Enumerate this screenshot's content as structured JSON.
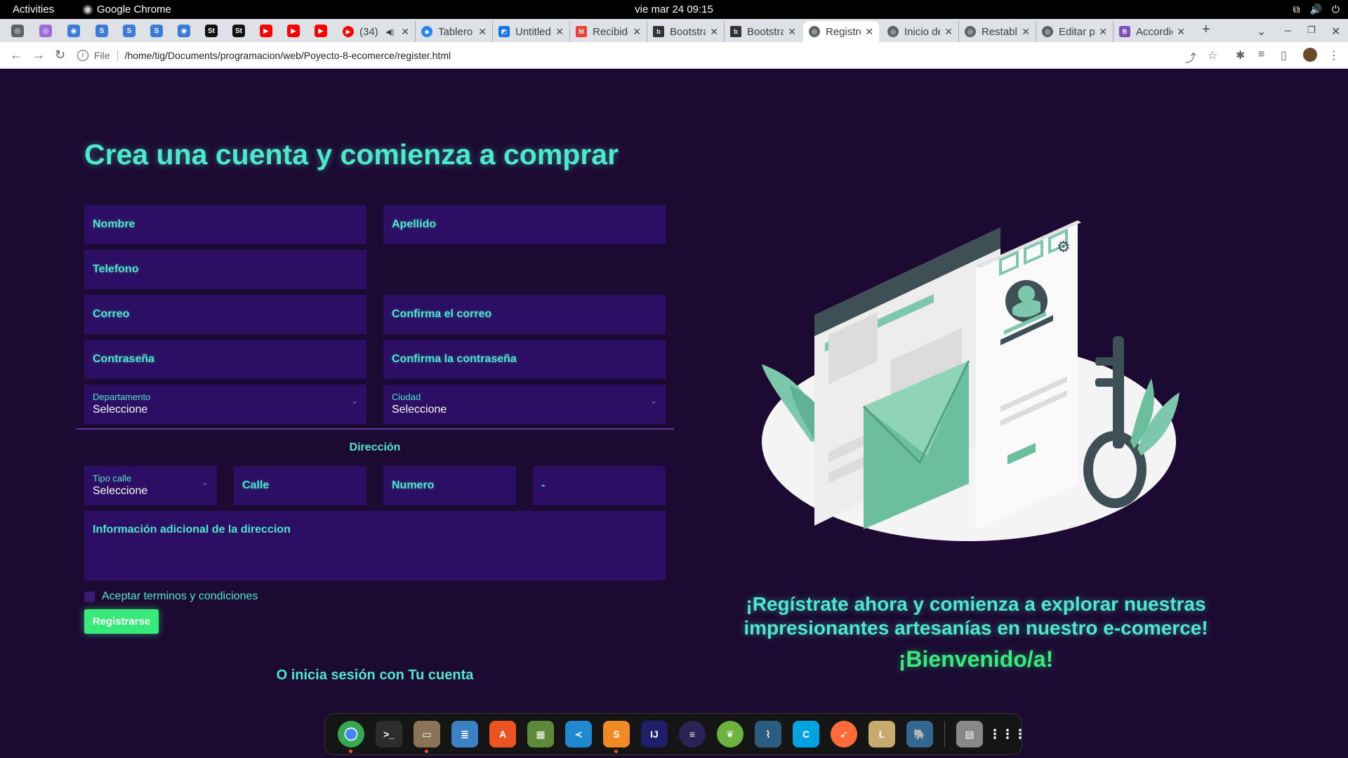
{
  "system_bar": {
    "activities": "Activities",
    "app_name": "Google Chrome",
    "clock": "vie mar 24  09:15"
  },
  "browser": {
    "tabs": [
      {
        "title": "(34)",
        "icon": "youtube-icon",
        "color": "#ff0000"
      },
      {
        "title": "Tablero",
        "icon": "jira-icon",
        "color": "#2684ff"
      },
      {
        "title": "Untitled",
        "icon": "diagram-icon",
        "color": "#1a73e8"
      },
      {
        "title": "Recibidos",
        "icon": "gmail-icon",
        "color": "#ea4335"
      },
      {
        "title": "Bootstrap",
        "icon": "bootstrap-icon",
        "color": "#333333"
      },
      {
        "title": "Bootstrap",
        "icon": "bootstrap-icon",
        "color": "#333333"
      },
      {
        "title": "Registro",
        "icon": "globe-icon",
        "color": "#5f6368"
      },
      {
        "title": "Inicio de",
        "icon": "globe-icon",
        "color": "#5f6368"
      },
      {
        "title": "Restablecer",
        "icon": "globe-icon",
        "color": "#5f6368"
      },
      {
        "title": "Editar p",
        "icon": "globe-icon",
        "color": "#5f6368"
      },
      {
        "title": "Accordion",
        "icon": "bootstrap-b-icon",
        "color": "#7952b3"
      }
    ],
    "address": {
      "scheme": "File",
      "url": "/home/tig/Documents/programacion/web/Poyecto-8-ecomerce/register.html"
    }
  },
  "form": {
    "heading": "Crea una cuenta y comienza a comprar",
    "nombre": "Nombre",
    "apellido": "Apellido",
    "telefono": "Telefono",
    "correo": "Correo",
    "confirma_correo": "Confirma el correo",
    "contrasena": "Contraseña",
    "confirma_contrasena": "Confirma la contraseña",
    "departamento": {
      "label": "Departamento",
      "value": "Seleccione"
    },
    "ciudad": {
      "label": "Ciudad",
      "value": "Seleccione"
    },
    "direccion_label": "Dirección",
    "tipo_calle": {
      "label": "Tipo calle",
      "value": "Seleccione"
    },
    "calle": "Calle",
    "numero": "Numero",
    "guion": "-",
    "info_adicional": "Información adicional de la direccion",
    "terminos": "Aceptar terminos y condiciones",
    "submit": "Registrarse",
    "login_link": "O inicia sesión con Tu cuenta"
  },
  "promo": {
    "text": "¡Regístrate ahora y comienza a explorar nuestras impresionantes artesanías en nuestro e-comerce!",
    "welcome": "¡Bienvenido/a!"
  },
  "colors": {
    "background": "#1c0a33",
    "field_bg": "#2c0e64",
    "accent_cyan": "#4ee8cc",
    "accent_green": "#38ea7a"
  },
  "dock": [
    {
      "name": "chrome-icon",
      "color": "#4285f4",
      "running": true,
      "active": true
    },
    {
      "name": "terminal-icon",
      "color": "#2d2d2d",
      "running": false
    },
    {
      "name": "files-icon",
      "color": "#8a7458",
      "running": true
    },
    {
      "name": "text-editor-icon",
      "color": "#3b82c4",
      "running": false
    },
    {
      "name": "app-center-icon",
      "color": "#e95420",
      "running": false
    },
    {
      "name": "minecraft-icon",
      "color": "#5d8a3a",
      "running": false
    },
    {
      "name": "vscode-icon",
      "color": "#1f8ad2",
      "running": false
    },
    {
      "name": "sublime-icon",
      "color": "#f08a24",
      "running": true
    },
    {
      "name": "intellij-icon",
      "color": "#1e1e6a",
      "running": false
    },
    {
      "name": "eclipse-icon",
      "color": "#2c2255",
      "running": false
    },
    {
      "name": "spring-icon",
      "color": "#6db33f",
      "running": false
    },
    {
      "name": "mysql-workbench-icon",
      "color": "#2b5d80",
      "running": false
    },
    {
      "name": "codeblocks-icon",
      "color": "#00a3e0",
      "running": false
    },
    {
      "name": "postman-icon",
      "color": "#ff6c37",
      "running": false
    },
    {
      "name": "league-icon",
      "color": "#c8aa6e",
      "running": false
    },
    {
      "name": "pgadmin-icon",
      "color": "#336791",
      "running": false
    },
    {
      "name": "disks-icon",
      "color": "#888888",
      "running": false
    },
    {
      "name": "app-grid-icon",
      "color": "#151515",
      "running": false
    }
  ]
}
